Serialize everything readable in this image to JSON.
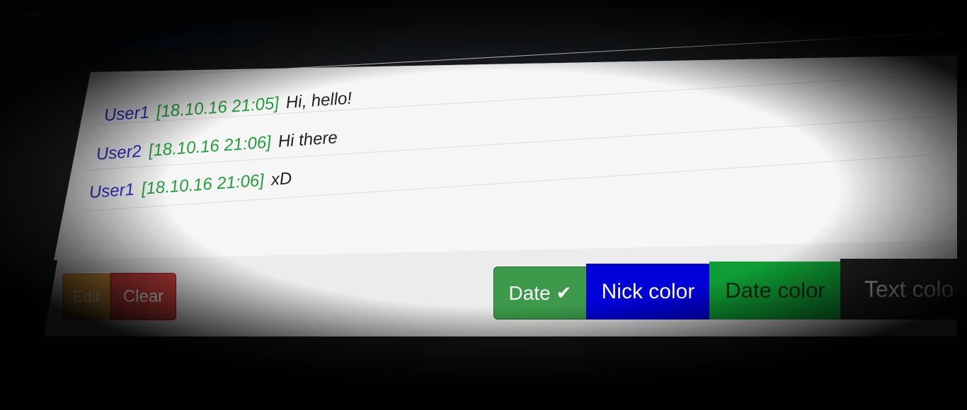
{
  "window": {
    "title": "...iagram"
  },
  "chat": {
    "messages": [
      {
        "nick": "User1",
        "date": "[18.10.16 21:05]",
        "text": "Hi, hello!"
      },
      {
        "nick": "User2",
        "date": "[18.10.16 21:06]",
        "text": "Hi there"
      },
      {
        "nick": "User1",
        "date": "[18.10.16 21:06]",
        "text": "xD"
      }
    ]
  },
  "toolbar": {
    "edit_label": "Edit",
    "clear_label": "Clear",
    "date_label": "Date",
    "date_check": "✔",
    "nick_color_label": "Nick color",
    "date_color_label": "Date color",
    "text_color_label": "Text colo"
  },
  "colors": {
    "nick": "#2a2fc4",
    "date": "#21a03a",
    "text": "#222222",
    "edit_button": "#d99a3a",
    "clear_button": "#c9403c",
    "date_button": "#3c9a4a",
    "nick_color_button": "#0000d8",
    "date_color_button": "#0f9e34",
    "text_color_button": "#222222"
  },
  "icons": {
    "date_toggle": "check-icon"
  }
}
